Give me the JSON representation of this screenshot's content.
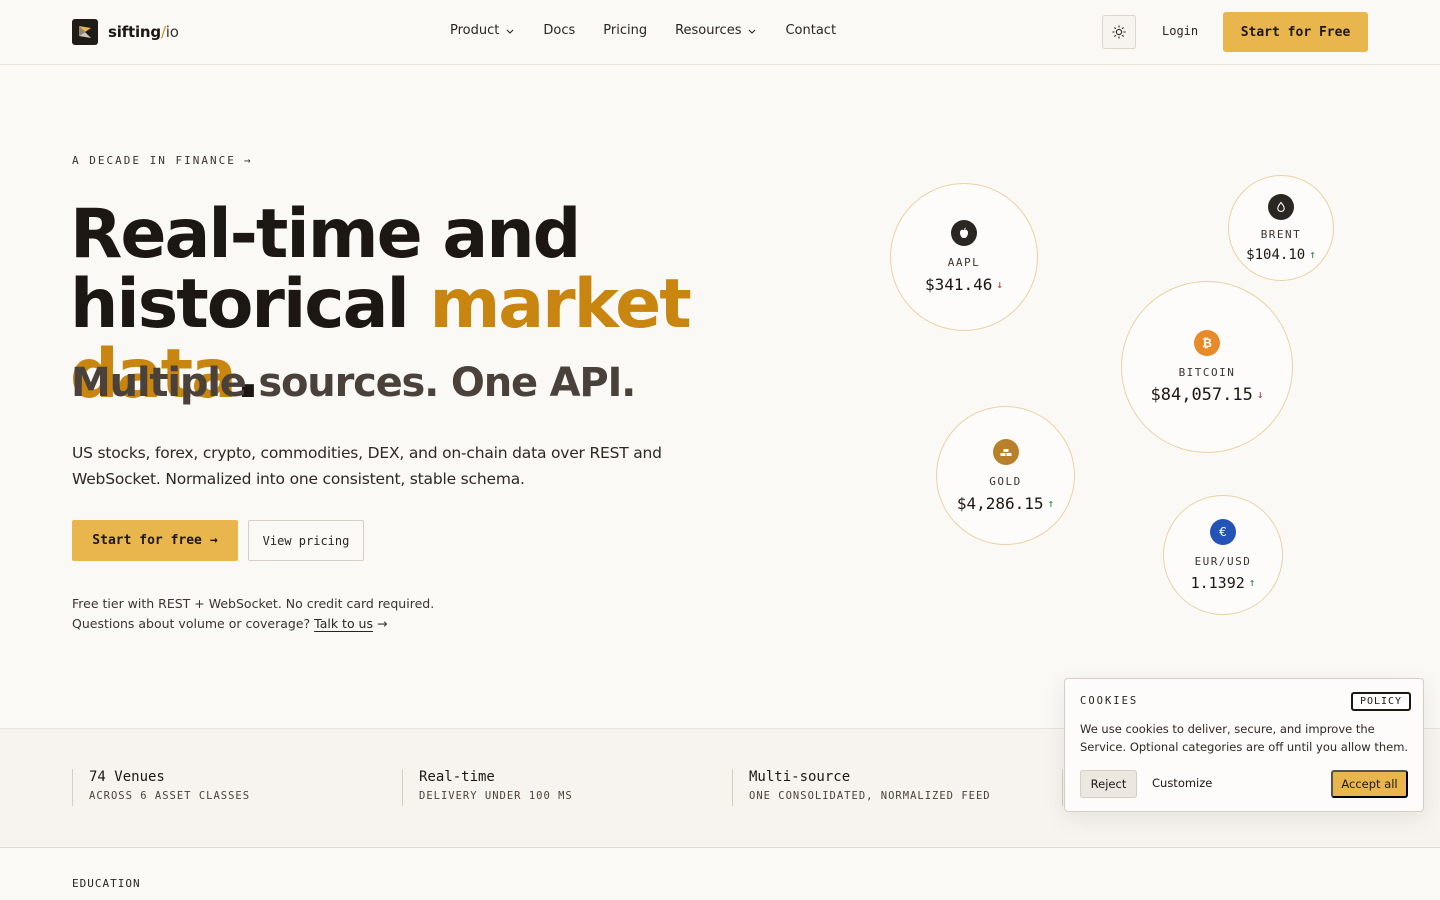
{
  "brand": {
    "name": "sifting",
    "slash": "/",
    "suffix": "io"
  },
  "nav": {
    "items": [
      {
        "label": "Product",
        "dropdown": true
      },
      {
        "label": "Docs",
        "dropdown": false
      },
      {
        "label": "Pricing",
        "dropdown": false
      },
      {
        "label": "Resources",
        "dropdown": true
      },
      {
        "label": "Contact",
        "dropdown": false
      }
    ],
    "login": "Login",
    "cta": "Start for Free",
    "theme_icon": "sun-icon"
  },
  "hero": {
    "eyebrow": "A DECADE IN FINANCE",
    "title_line1": "Real-time and",
    "title_line2_pre": "historical ",
    "title_line2_accent": "market data",
    "title_line2_post": ".",
    "subtitle": "Multiple sources. One API.",
    "lead": "US stocks, forex, crypto, commodities, DEX, and on-chain data over REST and WebSocket. Normalized into one consistent, stable schema.",
    "primary_cta": "Start for free",
    "secondary_cta": "View pricing",
    "note_line1": "Free tier with REST + WebSocket. No credit card required.",
    "note_line2_pre": "Questions about volume or coverage? ",
    "note_link": "Talk to us"
  },
  "tickers": [
    {
      "symbol": "AAPL",
      "price": "$341.46",
      "direction": "down",
      "icon": "apple-icon"
    },
    {
      "symbol": "BRENT",
      "price": "$104.10",
      "direction": "up",
      "icon": "oil-drop-icon"
    },
    {
      "symbol": "BITCOIN",
      "price": "$84,057.15",
      "direction": "down",
      "icon": "bitcoin-icon"
    },
    {
      "symbol": "GOLD",
      "price": "$4,286.15",
      "direction": "up",
      "icon": "gold-bars-icon"
    },
    {
      "symbol": "EUR/USD",
      "price": "1.1392",
      "direction": "up",
      "icon": "euro-icon"
    }
  ],
  "stats": [
    {
      "title": "74 Venues",
      "sub": "ACROSS 6 ASSET CLASSES"
    },
    {
      "title": "Real-time",
      "sub": "DELIVERY UNDER 100 MS"
    },
    {
      "title": "Multi-source",
      "sub": "ONE CONSOLIDATED, NORMALIZED FEED"
    }
  ],
  "section_label": "EDUCATION",
  "cookie": {
    "heading": "COOKIES",
    "policy": "POLICY",
    "body": "We use cookies to deliver, secure, and improve the Service. Optional categories are off until you allow them.",
    "reject": "Reject",
    "customize": "Customize",
    "accept": "Accept all"
  },
  "colors": {
    "accent": "#e9b64d",
    "accent_text": "#c8850f",
    "down": "#b5322a",
    "up": "#1f8a4c",
    "background": "#fbf9f6"
  }
}
